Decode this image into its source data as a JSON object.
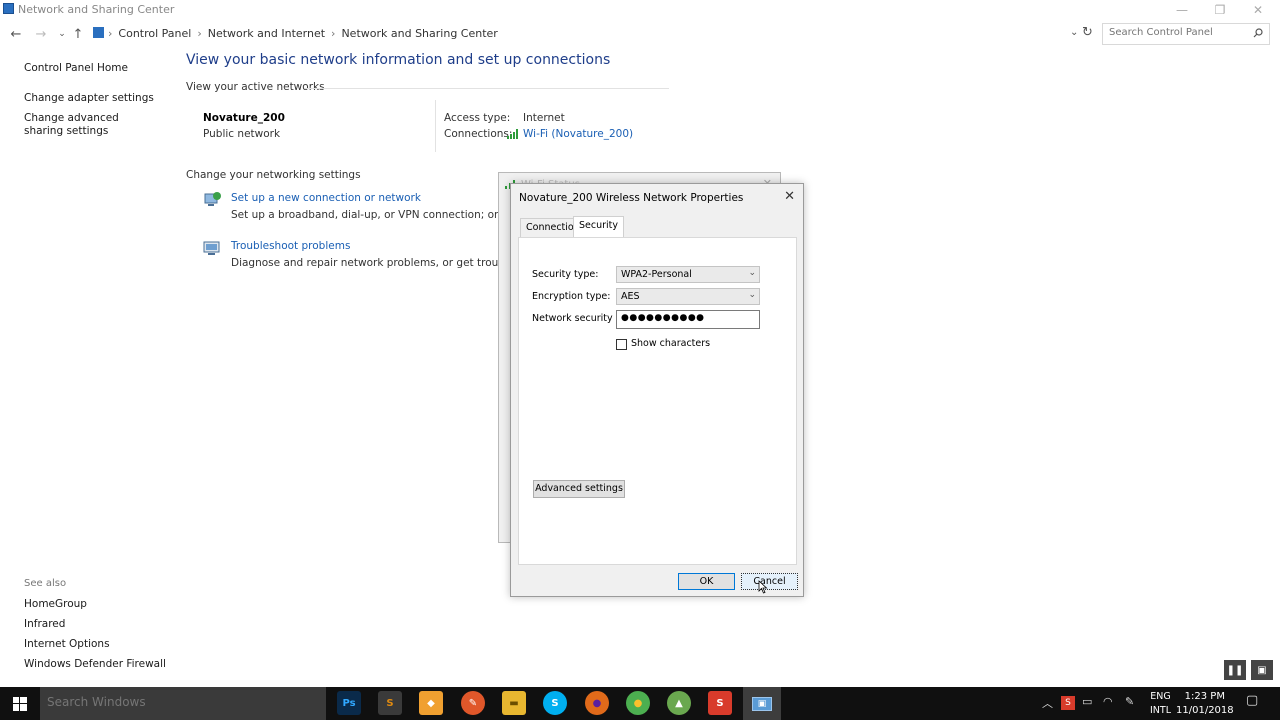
{
  "window": {
    "title": "Network and Sharing Center",
    "controls": {
      "minimize": "—",
      "maximize": "❐",
      "close": "✕"
    }
  },
  "address": {
    "crumbs": [
      "Control Panel",
      "Network and Internet",
      "Network and Sharing Center"
    ],
    "search_placeholder": "Search Control Panel"
  },
  "sidebar": {
    "home": "Control Panel Home",
    "links": [
      "Change adapter settings",
      "Change advanced sharing settings"
    ],
    "see_also_title": "See also",
    "see_also": [
      "HomeGroup",
      "Infrared",
      "Internet Options",
      "Windows Defender Firewall"
    ]
  },
  "main": {
    "heading": "View your basic network information and set up connections",
    "active_networks_title": "View your active networks",
    "network": {
      "name": "Novature_200",
      "type": "Public network",
      "access_label": "Access type:",
      "access_value": "Internet",
      "connections_label": "Connections:",
      "connections_value": "Wi-Fi (Novature_200)"
    },
    "change_settings_title": "Change your networking settings",
    "tasks": [
      {
        "link": "Set up a new connection or network",
        "desc": "Set up a broadband, dial-up, or VPN connection; or set up a r"
      },
      {
        "link": "Troubleshoot problems",
        "desc": "Diagnose and repair network problems, or get troubleshooti"
      }
    ]
  },
  "wifi_status": {
    "title": "Wi-Fi Status",
    "close": "✕"
  },
  "dialog": {
    "title": "Novature_200 Wireless Network Properties",
    "close": "✕",
    "tabs": [
      "Connection",
      "Security"
    ],
    "active_tab": "Security",
    "security_type_label": "Security type:",
    "security_type_value": "WPA2-Personal",
    "encryption_type_label": "Encryption type:",
    "encryption_type_value": "AES",
    "key_label": "Network security key",
    "key_value": "●●●●●●●●●●",
    "show_characters": "Show characters",
    "advanced": "Advanced settings",
    "ok": "OK",
    "cancel": "Cancel"
  },
  "taskbar": {
    "search_placeholder": "Search Windows",
    "apps": [
      {
        "name": "photoshop",
        "label": "Ps",
        "color": "#0a2a4a"
      },
      {
        "name": "sublime",
        "label": "S",
        "color": "#e08a10"
      },
      {
        "name": "app-orange",
        "label": "◆",
        "color": "#f0a030"
      },
      {
        "name": "app-pen",
        "label": "✎",
        "color": "#e0572a"
      },
      {
        "name": "file-explorer",
        "label": "▬",
        "color": "#e8b730"
      },
      {
        "name": "skype",
        "label": "S",
        "color": "#00aff0"
      },
      {
        "name": "firefox",
        "label": "●",
        "color": "#e06a1a"
      },
      {
        "name": "chrome",
        "label": "●",
        "color": "#4caf50"
      },
      {
        "name": "android-studio",
        "label": "▲",
        "color": "#6aa84f"
      },
      {
        "name": "sublime-red",
        "label": "S",
        "color": "#d83b2b"
      },
      {
        "name": "control-panel",
        "label": "▣",
        "color": "#5a9bd5"
      }
    ],
    "lang_top": "ENG",
    "lang_bottom": "INTL",
    "time": "1:23 PM",
    "date": "11/01/2018"
  }
}
